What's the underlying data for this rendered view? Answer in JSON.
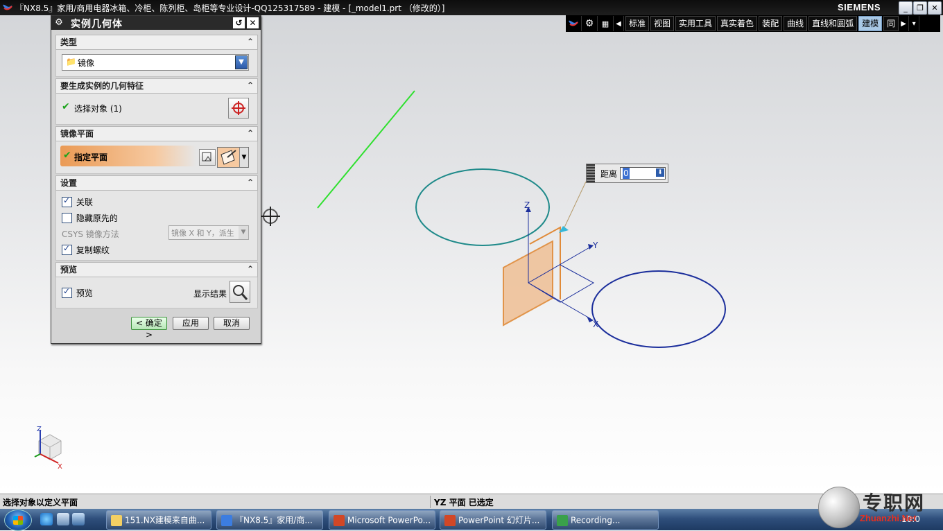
{
  "window": {
    "title": "『NX8.5』家用/商用电器冰箱、冷柜、陈列柜、岛柜等专业设计-QQ125317589 - 建模 - [_model1.prt （修改的）]",
    "brand": "SIEMENS",
    "minimize": "_",
    "restore": "❐",
    "close": "✕"
  },
  "toolbar": {
    "tabs": [
      "标准",
      "视图",
      "实用工具",
      "真实着色",
      "装配",
      "曲线",
      "直线和圆弧",
      "建模",
      "同"
    ],
    "active_tab": "建模"
  },
  "dialog": {
    "title": "实例几何体",
    "sections": {
      "type": {
        "header": "类型",
        "dropdown_value": "镜像"
      },
      "features": {
        "header": "要生成实例的几何特征",
        "select_label": "选择对象 (1)"
      },
      "mirror_plane": {
        "header": "镜像平面",
        "specify_label": "指定平面"
      },
      "settings": {
        "header": "设置",
        "associative_label": "关联",
        "associative_checked": true,
        "hide_original_label": "隐藏原先的",
        "hide_original_checked": false,
        "csys_label": "CSYS 镜像方法",
        "csys_value": "镜像 X 和 Y，派生",
        "copy_threads_label": "复制螺纹",
        "copy_threads_checked": true
      },
      "preview": {
        "header": "预览",
        "preview_label": "预览",
        "preview_checked": true,
        "show_result_label": "显示结果"
      }
    },
    "buttons": {
      "ok": "< 确定 >",
      "apply": "应用",
      "cancel": "取消"
    }
  },
  "viewport": {
    "distance_label": "距离",
    "distance_value": "0",
    "axes": {
      "x": "X",
      "y": "Y",
      "z": "Z"
    },
    "mini_triad": {
      "x": "X",
      "z": "Z"
    }
  },
  "statusbar": {
    "prompt": "选择对象以定义平面",
    "message": "YZ 平面 已选定"
  },
  "taskbar": {
    "items": [
      "151.NX建模来自曲...",
      "『NX8.5』家用/商...",
      "Microsoft PowerPo...",
      "PowerPoint 幻灯片...",
      "Recording..."
    ],
    "clock": "10:0"
  },
  "watermark": {
    "text": "专职网",
    "url": "Zhuanzhi.Net"
  },
  "colors": {
    "accent_orange": "#e89a4a",
    "circle_teal": "#1f8a8a",
    "circle_blue": "#1c2f9c",
    "line_green": "#2ee02e"
  }
}
